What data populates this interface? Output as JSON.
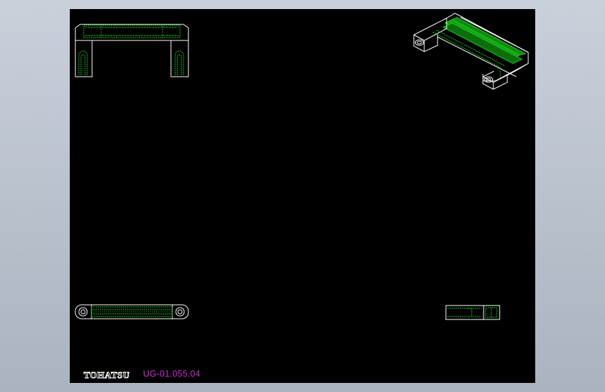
{
  "title_block": {
    "brand": "TOHATSU",
    "part_number": "UG-01.055.04"
  },
  "colors": {
    "background": "#aeb6c2",
    "sheet": "#000000",
    "outline": "#ffffff",
    "hidden_detail": "#16c916",
    "part_number_text": "#d42ad4"
  }
}
